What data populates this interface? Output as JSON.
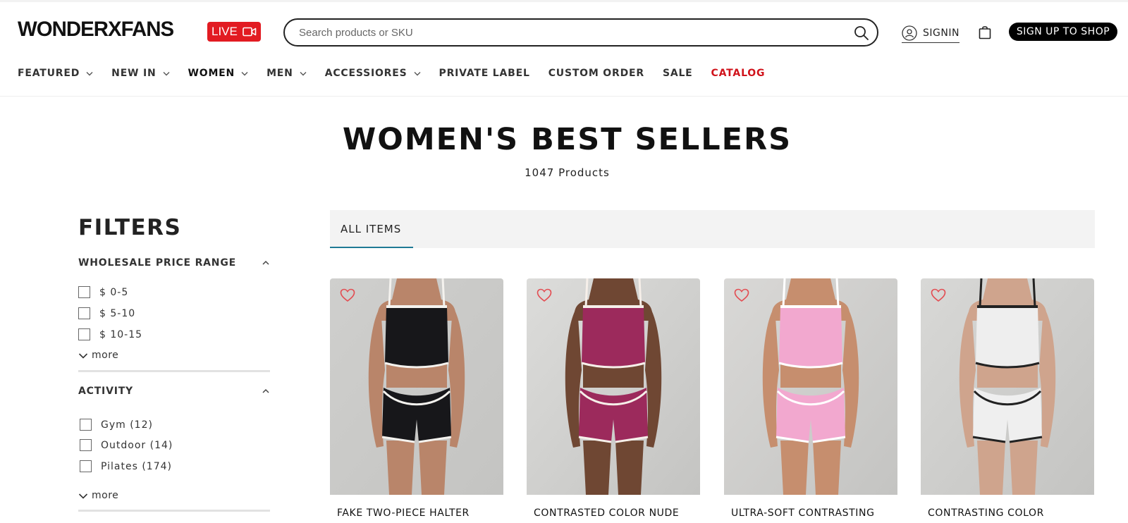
{
  "header": {
    "logo": "WONDERXFANS",
    "live_label": "LIVE",
    "search_placeholder": "Search products or SKU",
    "signin_label": "SIGNIN",
    "signup_label": "SIGN UP TO SHOP"
  },
  "nav": [
    {
      "label": "FEATURED",
      "dropdown": true
    },
    {
      "label": "NEW IN",
      "dropdown": true
    },
    {
      "label": "WOMEN",
      "dropdown": true
    },
    {
      "label": "MEN",
      "dropdown": true
    },
    {
      "label": "ACCESSIORES",
      "dropdown": true
    },
    {
      "label": "PRIVATE LABEL",
      "dropdown": false
    },
    {
      "label": "CUSTOM ORDER",
      "dropdown": false
    },
    {
      "label": "SALE",
      "dropdown": false
    },
    {
      "label": "CATALOG",
      "dropdown": false,
      "color": "#d0131b"
    }
  ],
  "page": {
    "title": "WOMEN'S BEST SELLERS",
    "count": "1047 Products"
  },
  "filters": {
    "title": "FILTERS",
    "groups": [
      {
        "title": "WHOLESALE PRICE RANGE",
        "options": [
          "$ 0-5",
          "$ 5-10",
          "$ 10-15"
        ],
        "more_label": "more"
      },
      {
        "title": "ACTIVITY",
        "options": [
          "Gym (12)",
          "Outdoor (14)",
          "Pilates (174)"
        ],
        "more_label": "more"
      }
    ]
  },
  "tabs": {
    "all_items": "ALL ITEMS"
  },
  "products": [
    {
      "name": "FAKE TWO-PIECE HALTER",
      "top_color": "#17171a",
      "bottom_color": "#17171a",
      "trim": "#f4f2ee",
      "skin": "#b9856a",
      "bg": "#cfcfcd"
    },
    {
      "name": "CONTRASTED COLOR NUDE",
      "top_color": "#9c2a5c",
      "bottom_color": "#9c2a5c",
      "trim": "#f6efe9",
      "skin": "#6f4733",
      "bg": "#dcdcda"
    },
    {
      "name": "ULTRA-SOFT CONTRASTING",
      "top_color": "#f2a8cf",
      "bottom_color": "#f2a8cf",
      "trim": "#ffffff",
      "skin": "#c68e6e",
      "bg": "#d9d8d6"
    },
    {
      "name": "CONTRASTING COLOR",
      "top_color": "#eeeeee",
      "bottom_color": "#efefef",
      "trim": "#222222",
      "skin": "#cfa48d",
      "bg": "#d8d8d6"
    }
  ],
  "colors": {
    "accent_red": "#e21b22",
    "tab_underline": "#1f7a95",
    "heart": "#e34d52"
  }
}
